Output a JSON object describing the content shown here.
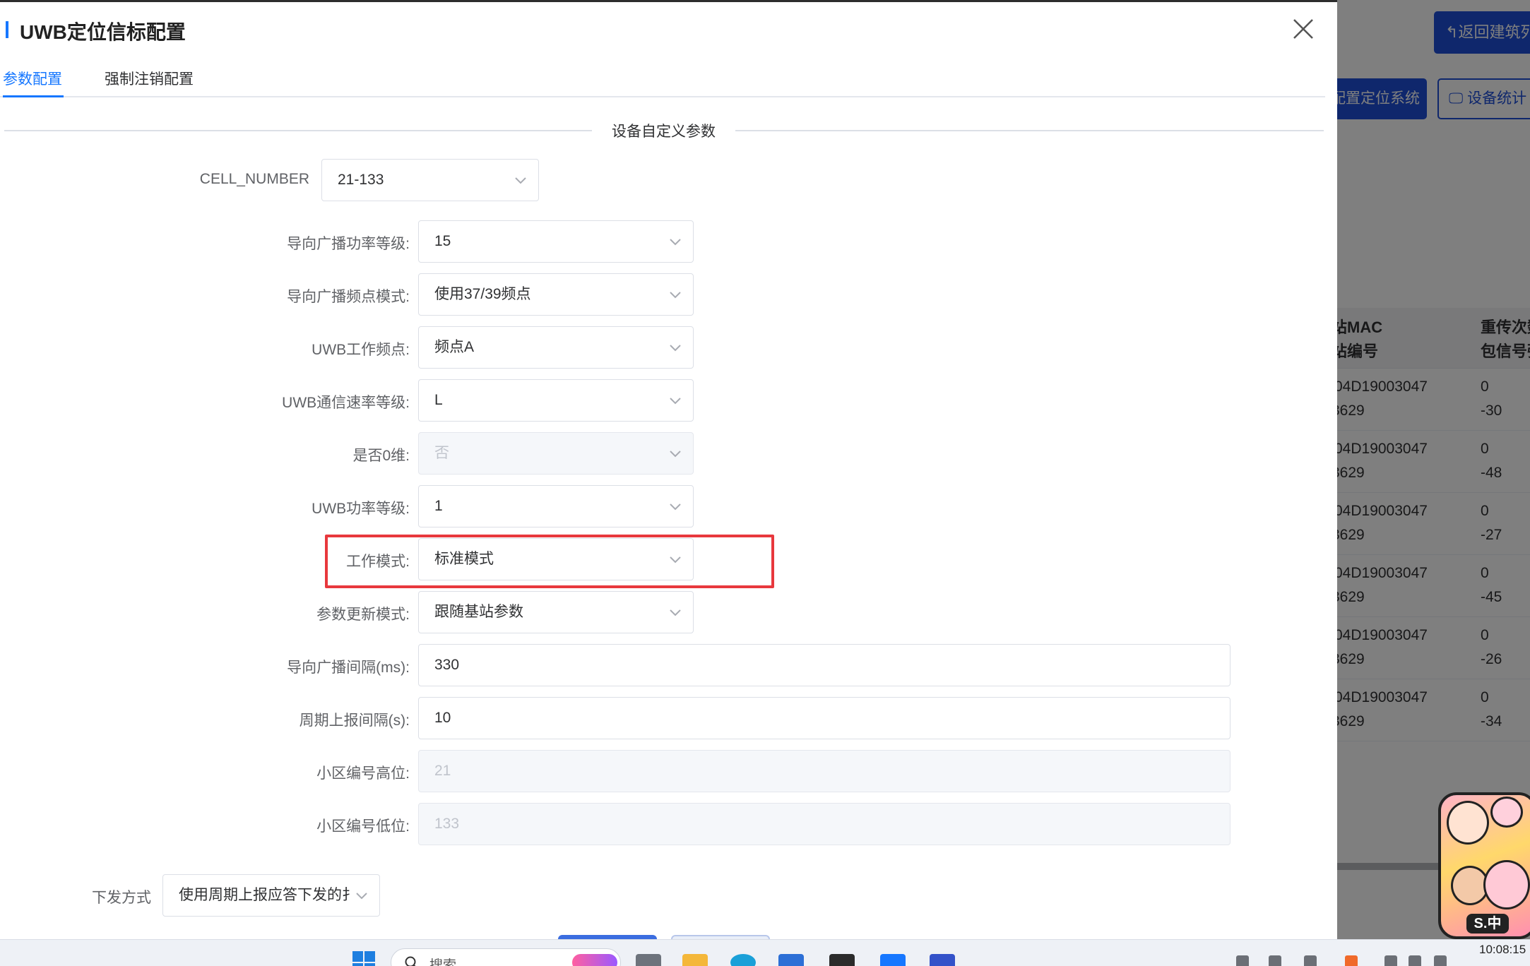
{
  "modal": {
    "title": "UWB定位信标配置",
    "tabs": [
      {
        "label": "参数配置",
        "active": true
      },
      {
        "label": "强制注销配置",
        "active": false
      }
    ],
    "section_title": "设备自定义参数",
    "cell_number": {
      "label": "CELL_NUMBER",
      "value": "21-133"
    },
    "fields": [
      {
        "label": "导向广播功率等级:",
        "value": "15",
        "type": "select",
        "disabled": false
      },
      {
        "label": "导向广播频点模式:",
        "value": "使用37/39频点",
        "type": "select",
        "disabled": false
      },
      {
        "label": "UWB工作频点:",
        "value": "频点A",
        "type": "select",
        "disabled": false
      },
      {
        "label": "UWB通信速率等级:",
        "value": "L",
        "type": "select",
        "disabled": false
      },
      {
        "label": "是否0维:",
        "value": "否",
        "type": "select",
        "disabled": true
      },
      {
        "label": "UWB功率等级:",
        "value": "1",
        "type": "select",
        "disabled": false
      },
      {
        "label": "工作模式:",
        "value": "标准模式",
        "type": "select",
        "disabled": false
      },
      {
        "label": "参数更新模式:",
        "value": "跟随基站参数",
        "type": "select",
        "disabled": false
      },
      {
        "label": "导向广播间隔(ms):",
        "value": "330",
        "type": "input",
        "disabled": false
      },
      {
        "label": "周期上报间隔(s):",
        "value": "10",
        "type": "input",
        "disabled": false
      },
      {
        "label": "小区编号高位:",
        "value": "21",
        "type": "input",
        "disabled": true
      },
      {
        "label": "小区编号低位:",
        "value": "133",
        "type": "input",
        "disabled": true
      }
    ],
    "delivery": {
      "label": "下发方式",
      "value": "使用周期上报应答下发的扌"
    }
  },
  "background": {
    "buttons": {
      "back": "返回建筑列",
      "config": "配置定位系统",
      "stats": "设备统计"
    },
    "table": {
      "headers": [
        [
          "站MAC",
          "站编号"
        ],
        [
          "重传次数",
          "包信号强"
        ]
      ],
      "rows": [
        {
          "mac": "04D19003047",
          "id": "3629",
          "retry": "0",
          "rssi": "-30"
        },
        {
          "mac": "04D19003047",
          "id": "3629",
          "retry": "0",
          "rssi": "-48"
        },
        {
          "mac": "04D19003047",
          "id": "3629",
          "retry": "0",
          "rssi": "-27"
        },
        {
          "mac": "04D19003047",
          "id": "3629",
          "retry": "0",
          "rssi": "-45"
        },
        {
          "mac": "04D19003047",
          "id": "3629",
          "retry": "0",
          "rssi": "-26"
        },
        {
          "mac": "04D19003047",
          "id": "3629",
          "retry": "0",
          "rssi": "-34"
        }
      ]
    },
    "sticker_text": "S.中"
  },
  "taskbar": {
    "search_placeholder": "搜索",
    "time": "10:08:15"
  },
  "colors": {
    "primary": "#1677ff",
    "highlight_border": "#e8383d",
    "app_button": "#1f4fd9"
  }
}
